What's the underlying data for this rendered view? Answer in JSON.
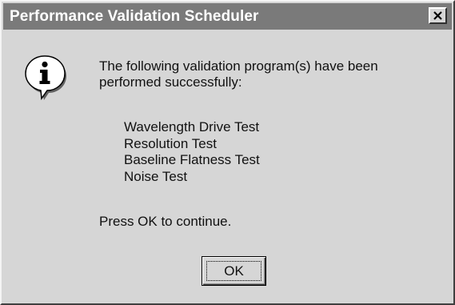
{
  "window": {
    "title": "Performance Validation Scheduler"
  },
  "icons": {
    "dialog_icon": "info-icon",
    "close": "close-icon"
  },
  "colors": {
    "titlebar": "#7a7a7a",
    "dialog_background": "#d6d6d6",
    "title_text": "#ffffff"
  },
  "message": {
    "text": "The following validation program(s) have been performed successfully:"
  },
  "tests": [
    "Wavelength Drive Test",
    "Resolution Test",
    "Baseline Flatness Test",
    "Noise Test"
  ],
  "prompt": "Press OK to continue.",
  "buttons": {
    "ok_label": "OK"
  }
}
